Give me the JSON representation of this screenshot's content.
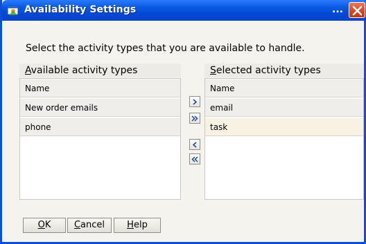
{
  "window": {
    "title": "Availability Settings",
    "overflow_indicator": "...",
    "icons": {
      "app": "app-window-icon",
      "close": "close-icon"
    }
  },
  "instruction": "Select the activity types that you are available to handle.",
  "available": {
    "header_prefix": "A",
    "header_rest": "vailable activity types",
    "rows": [
      "Name",
      "New order emails",
      "phone"
    ]
  },
  "selected": {
    "header_prefix": "S",
    "header_rest": "elected activity types",
    "rows": [
      "Name",
      "email",
      "task"
    ]
  },
  "buttons": {
    "ok_prefix": "O",
    "ok_rest": "K",
    "cancel_prefix": "C",
    "cancel_rest": "ancel",
    "help_prefix": "H",
    "help_rest": "elp"
  },
  "transfer_icons": [
    "move-right-icon",
    "move-all-right-icon",
    "move-left-icon",
    "move-all-left-icon"
  ],
  "colors": {
    "titlebar": "#0a5ae0",
    "close": "#d6431c",
    "selected_row": "#f8f2e3",
    "arrow": "#1a4aa0"
  }
}
